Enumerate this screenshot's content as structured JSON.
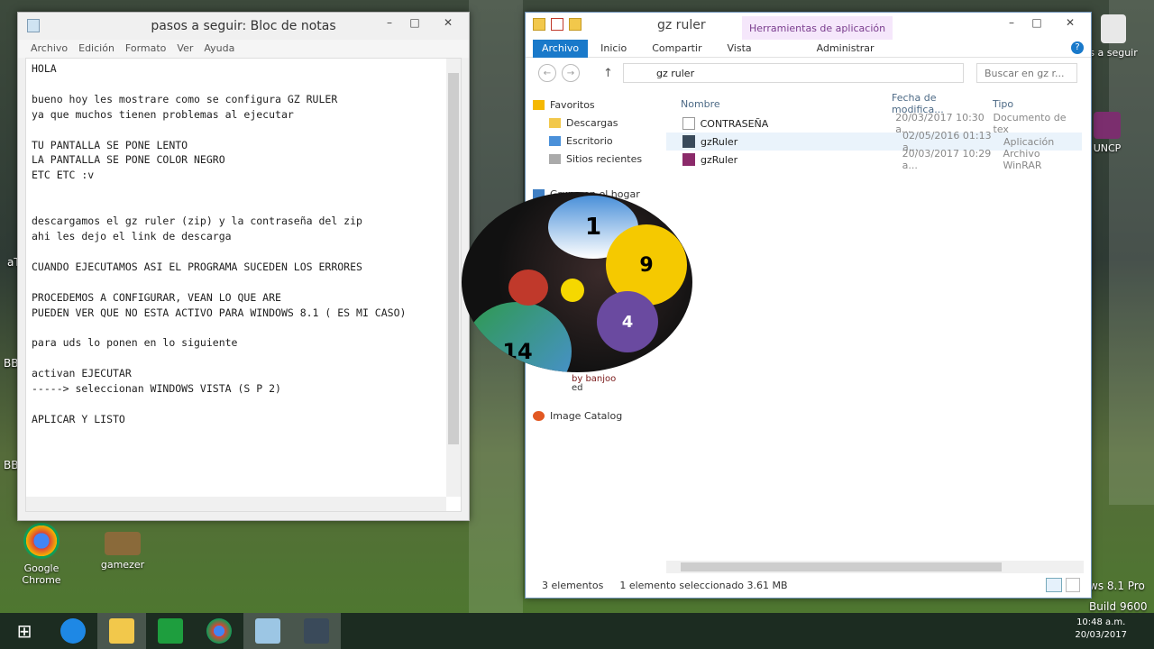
{
  "notepad": {
    "title": "pasos a seguir: Bloc de notas",
    "menu": [
      "Archivo",
      "Edición",
      "Formato",
      "Ver",
      "Ayuda"
    ],
    "text": "HOLA\n\nbueno hoy les mostrare como se configura GZ RULER\nya que muchos tienen problemas al ejecutar\n\nTU PANTALLA SE PONE LENTO\nLA PANTALLA SE PONE COLOR NEGRO\nETC ETC :v\n\n\ndescargamos el gz ruler (zip) y la contraseña del zip\nahi les dejo el link de descarga\n\nCUANDO EJECUTAMOS ASI EL PROGRAMA SUCEDEN LOS ERRORES\n\nPROCEDEMOS A CONFIGURAR, VEAN LO QUE ARE\nPUEDEN VER QUE NO ESTA ACTIVO PARA WINDOWS 8.1 ( ES MI CASO)\n\npara uds lo ponen en lo siguiente\n\nactivan EJECUTAR\n-----> seleccionan WINDOWS VISTA (S P 2)\n\nAPLICAR Y LISTO"
  },
  "explorer": {
    "title": "gz ruler",
    "context_tab": "Herramientas de aplicación",
    "ribbon": [
      "Archivo",
      "Inicio",
      "Compartir",
      "Vista",
      "Administrar"
    ],
    "address": "gz ruler",
    "search_placeholder": "Buscar en gz r...",
    "nav": [
      {
        "label": "Favoritos",
        "icon": "star-icon"
      },
      {
        "label": "Descargas",
        "icon": "folder-icon"
      },
      {
        "label": "Escritorio",
        "icon": "folder-icon"
      },
      {
        "label": "Sitios recientes",
        "icon": "folder-icon"
      },
      {
        "label": "Grupo en el hogar",
        "icon": "homegroup-icon"
      },
      {
        "label": "Image Catalog",
        "icon": "catalog-icon"
      }
    ],
    "columns": [
      "Nombre",
      "Fecha de modifica...",
      "Tipo"
    ],
    "files": [
      {
        "name": "CONTRASEÑA",
        "date": "20/03/2017 10:30 a...",
        "type": "Documento de tex",
        "selected": false
      },
      {
        "name": "gzRuler",
        "date": "02/05/2016 01:13 a...",
        "type": "Aplicación",
        "selected": true
      },
      {
        "name": "gzRuler",
        "date": "20/03/2017 10:29 a...",
        "type": "Archivo WinRAR",
        "selected": false
      }
    ],
    "status_count": "3 elementos",
    "status_selected": "1 elemento seleccionado  3.61 MB"
  },
  "overlay": {
    "credit_1": "by banjoo",
    "credit_2": "ed",
    "ball_numbers": [
      "1",
      "9",
      "4",
      "14"
    ]
  },
  "desktop": {
    "icons": [
      {
        "label": "Google Chrome",
        "color": "#2e8b3c"
      },
      {
        "label": "gamezer",
        "color": "#8a6a3a"
      },
      {
        "label": "UNCP",
        "color": "#7b2e6e"
      },
      {
        "label": "s a seguir",
        "color": "#e8e8e8"
      }
    ],
    "edge_labels": [
      "aT",
      "BB",
      "BB"
    ],
    "watermark_1": "ws 8.1 Pro",
    "watermark_2": "Build 9600"
  },
  "taskbar": {
    "time": "10:48 a.m.",
    "date": "20/03/2017"
  }
}
